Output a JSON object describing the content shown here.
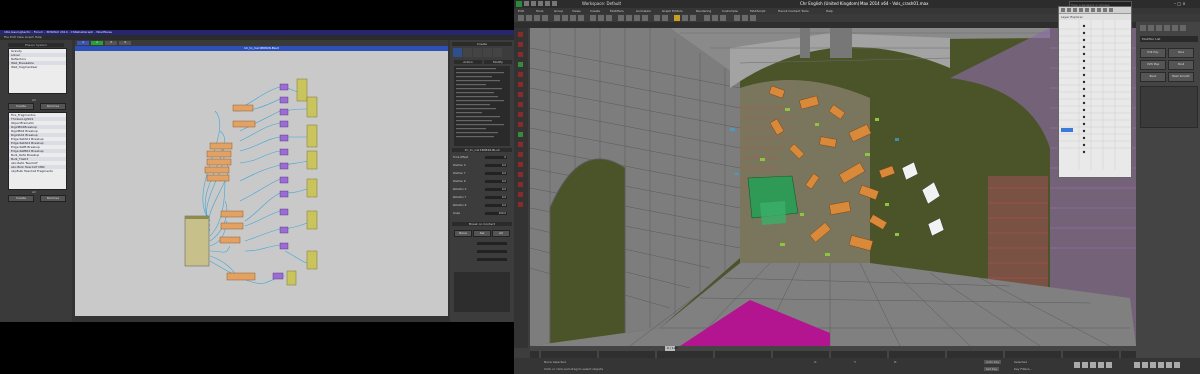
{
  "left_app": {
    "window_title": "1DA.IssuingSectic - Forum - 3DSMAX 2014 - ChRehabGraph - WiadTaxes",
    "menu": "File  Edit  View  Graph  Help",
    "graph_title": "1C_to_Car1B0826-BLull",
    "tabs": [
      "1",
      "2",
      "3",
      "4"
    ],
    "scene_system_header": "Phaser System",
    "scene_items": [
      "Gravity",
      "solver",
      "Reflectors",
      "Wall_Breakable",
      "Wall_fragmentaer"
    ],
    "scene_buttons": [
      "Create",
      "Remove"
    ],
    "scene_label": "All",
    "objects_list": [
      "Fire_Fragmentos",
      "ThinkerLight01",
      "ObjectFrame01",
      "RigidB01Breakup",
      "RigidB02 Breakup",
      "RigidA01 Breakup",
      "Edge RefA01 Breakup",
      "Edge RefA02 Breakup",
      "Edge RefB Breakup",
      "Edge RefB02 Breakup",
      "Bulk_RefA Breakup",
      "Bulk_Tile03",
      "abc.RefA TwerCAT",
      "abc.Bulk TwerCAT MRC",
      "obj.Bulk TwerCat Fragments"
    ],
    "objects_buttons": [
      "Create",
      "Remove"
    ],
    "objects_label": "All",
    "rpanel_header": "Create",
    "rpanel_tabs": [
      "Action",
      "Modify"
    ],
    "rpanel_rows": [
      {
        "label": "Time Offset",
        "value": "0"
      },
      {
        "label": "Position X",
        "value": "0.0"
      },
      {
        "label": "Position Y",
        "value": "0.0"
      },
      {
        "label": "Position Z",
        "value": "0.0"
      },
      {
        "label": "Rotation X",
        "value": "0.0"
      },
      {
        "label": "Rotation Y",
        "value": "0.0"
      },
      {
        "label": "Rotation Z",
        "value": "0.0"
      },
      {
        "label": "Scale",
        "value": "100.0"
      }
    ],
    "rpanel_section": "Break on Contact",
    "rpanel_buttons": [
      "None",
      "Sel",
      "All"
    ]
  },
  "right_app": {
    "title": "Workspace: Default",
    "title_center": "Chr English (United Kingdom)",
    "file_title": "Max 2014 x64 - Vols_crash01.max",
    "search_placeholder": "Type a keyword or phrase",
    "menu": [
      "Edit",
      "Tools",
      "Group",
      "Views",
      "Create",
      "Modifiers",
      "Animation",
      "Graph Editors",
      "Rendering",
      "Customize",
      "MAXScript",
      "Havok Content Tools",
      "Help"
    ],
    "layer_window_title": "Layer Explorer",
    "cmd_panel": {
      "title": "Modifier List",
      "buttons": [
        "Edit Poly",
        "Slice",
        "UVW Map",
        "Shell",
        "Bend",
        "Mesh Smooth"
      ]
    },
    "timeline": {
      "frame": "0 / 100",
      "ticks": [
        "0",
        "10",
        "20",
        "30",
        "40",
        "50",
        "60",
        "70",
        "80",
        "90",
        "100"
      ]
    },
    "status": {
      "selection": "None Selected",
      "prompt": "Click or click-and-drag to select objects",
      "autokey": "Auto Key",
      "setkey": "Set Key",
      "selected": "Selected",
      "key_filters": "Key Filters...",
      "coord_x": "X:",
      "coord_y": "Y:",
      "coord_z": "Z:"
    },
    "colors": {
      "wall_green": "#4c5a2a",
      "wire_gray": "#7a7a7a",
      "debris_orange": "#d88a3a",
      "debris_green": "#2f9a55",
      "floor_magenta": "#b2158f"
    }
  }
}
